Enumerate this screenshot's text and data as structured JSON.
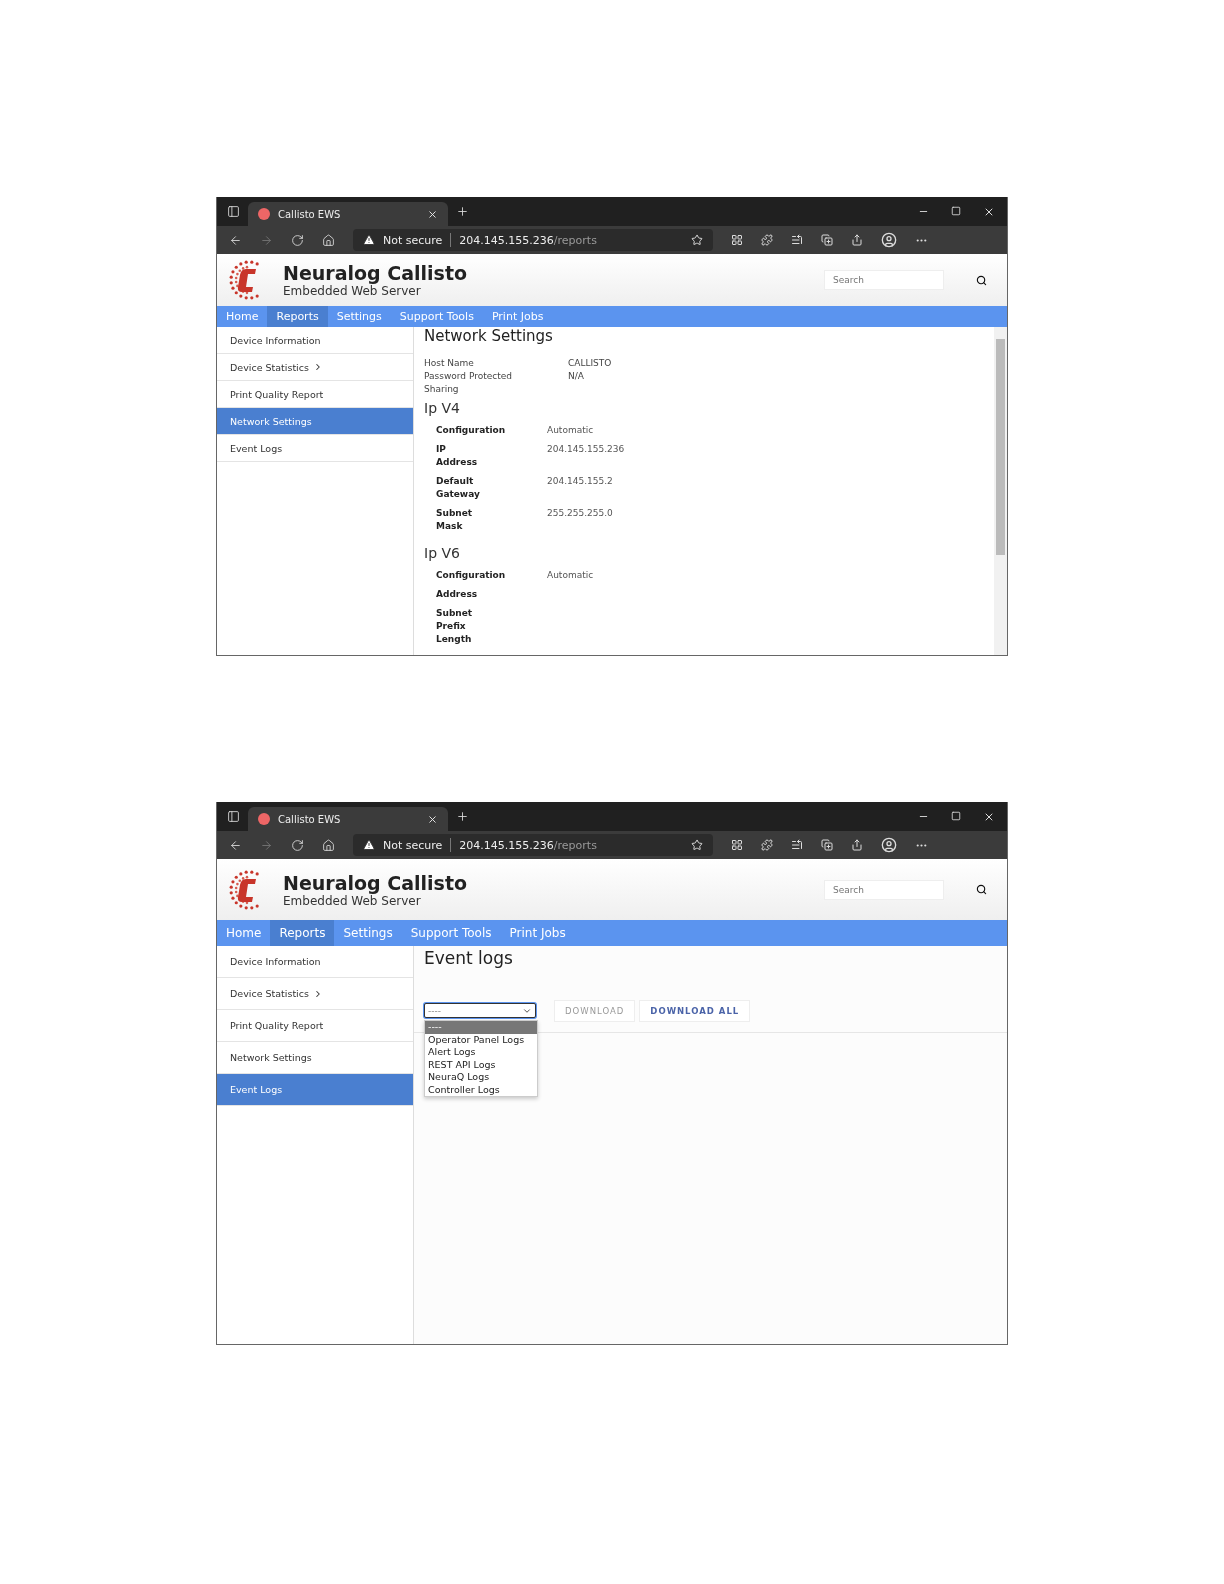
{
  "screenshots": [
    {
      "browser": {
        "tab_title": "Callisto EWS",
        "security": "Not secure",
        "url_host": "204.145.155.236",
        "url_path": "/reports"
      },
      "header": {
        "title": "Neuralog Callisto",
        "subtitle": "Embedded Web Server",
        "search": {
          "placeholder": "Search"
        }
      },
      "nav": [
        {
          "label": "Home",
          "selected": false
        },
        {
          "label": "Reports",
          "selected": true
        },
        {
          "label": "Settings",
          "selected": false
        },
        {
          "label": "Support Tools",
          "selected": false
        },
        {
          "label": "Print Jobs",
          "selected": false
        }
      ],
      "sidebar": [
        {
          "label": "Device Information",
          "selected": false,
          "submenu": false
        },
        {
          "label": "Device Statistics",
          "selected": false,
          "submenu": true
        },
        {
          "label": "Print Quality Report",
          "selected": false,
          "submenu": false
        },
        {
          "label": "Network Settings",
          "selected": true,
          "submenu": false
        },
        {
          "label": "Event Logs",
          "selected": false,
          "submenu": false
        }
      ],
      "content": {
        "kind": "network",
        "title": "Network Settings",
        "fields": [
          {
            "label": "Host Name",
            "value": "CALLISTO"
          },
          {
            "label": "Password Protected",
            "value": "N/A"
          },
          {
            "label": "Sharing"
          }
        ],
        "sections": [
          {
            "title": "Ip V4",
            "rows": [
              {
                "label": "Configuration",
                "value": "Automatic"
              },
              {
                "label": "IP Address",
                "value": "204.145.155.236"
              },
              {
                "label": "Default Gateway",
                "value": "204.145.155.2"
              },
              {
                "label": "Subnet Mask",
                "value": "255.255.255.0"
              }
            ]
          },
          {
            "title": "Ip V6",
            "rows": [
              {
                "label": "Configuration",
                "value": "Automatic"
              },
              {
                "label": "Address"
              },
              {
                "label": "Subnet Prefix Length"
              }
            ]
          }
        ]
      }
    },
    {
      "browser": {
        "tab_title": "Callisto EWS",
        "security": "Not secure",
        "url_host": "204.145.155.236",
        "url_path": "/reports"
      },
      "header": {
        "title": "Neuralog Callisto",
        "subtitle": "Embedded Web Server",
        "search": {
          "placeholder": "Search"
        }
      },
      "nav": [
        {
          "label": "Home",
          "selected": false
        },
        {
          "label": "Reports",
          "selected": true
        },
        {
          "label": "Settings",
          "selected": false
        },
        {
          "label": "Support Tools",
          "selected": false
        },
        {
          "label": "Print Jobs",
          "selected": false
        }
      ],
      "sidebar": [
        {
          "label": "Device Information",
          "selected": false,
          "submenu": false
        },
        {
          "label": "Device Statistics",
          "selected": false,
          "submenu": true
        },
        {
          "label": "Print Quality Report",
          "selected": false,
          "submenu": false
        },
        {
          "label": "Network Settings",
          "selected": false,
          "submenu": false
        },
        {
          "label": "Event Logs",
          "selected": true,
          "submenu": false
        }
      ],
      "content": {
        "kind": "logs",
        "title": "Event logs",
        "select": {
          "value": "----",
          "expanded": true,
          "options": [
            {
              "label": "----",
              "selected": true
            },
            {
              "label": "Operator Panel Logs",
              "selected": false
            },
            {
              "label": "Alert Logs",
              "selected": false
            },
            {
              "label": "REST API Logs",
              "selected": false
            },
            {
              "label": "NeuraQ Logs",
              "selected": false
            },
            {
              "label": "Controller Logs",
              "selected": false
            }
          ]
        },
        "buttons": [
          {
            "label": "DOWNLOAD",
            "disabled": true
          },
          {
            "label": "DOWNLOAD ALL",
            "disabled": false
          }
        ]
      }
    }
  ]
}
